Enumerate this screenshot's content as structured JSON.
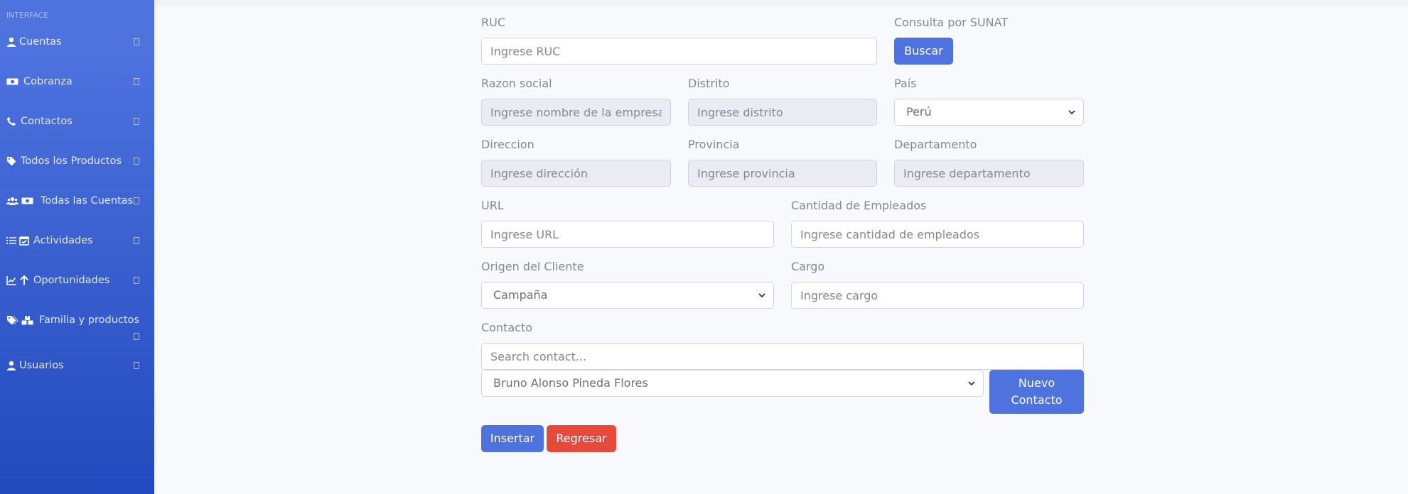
{
  "sidebar": {
    "heading": "INTERFACE",
    "items": [
      {
        "label": "Cuentas",
        "icons": [
          "user-icon"
        ]
      },
      {
        "label": "Cobranza",
        "icons": [
          "money-bill-icon"
        ]
      },
      {
        "label": "Contactos",
        "icons": [
          "phone-icon"
        ]
      },
      {
        "label": "Todos los Productos",
        "icons": [
          "tag-icon"
        ]
      },
      {
        "label": "Todas las Cuentas",
        "icons": [
          "users-icon",
          "money-bill-icon"
        ]
      },
      {
        "label": "Actividades",
        "icons": [
          "list-icon",
          "calendar-check-icon"
        ]
      },
      {
        "label": "Oportunidades",
        "icons": [
          "chart-line-icon",
          "arrow-up-icon"
        ]
      },
      {
        "label": "Familia y productos",
        "icons": [
          "tags-icon",
          "boxes-icon"
        ]
      },
      {
        "label": "Usuarios",
        "icons": [
          "user-icon"
        ]
      }
    ]
  },
  "form": {
    "ruc": {
      "label": "RUC",
      "placeholder": "Ingrese RUC"
    },
    "sunat": {
      "label": "Consulta por SUNAT",
      "button": "Buscar"
    },
    "razon_social": {
      "label": "Razon social",
      "placeholder": "Ingrese nombre de la empresa"
    },
    "distrito": {
      "label": "Distrito",
      "placeholder": "Ingrese distrito"
    },
    "pais": {
      "label": "País",
      "value": "Perú"
    },
    "direccion": {
      "label": "Direccion",
      "placeholder": "Ingrese dirección"
    },
    "provincia": {
      "label": "Provincia",
      "placeholder": "Ingrese provincia"
    },
    "departamento": {
      "label": "Departamento",
      "placeholder": "Ingrese departamento"
    },
    "url": {
      "label": "URL",
      "placeholder": "Ingrese URL"
    },
    "empleados": {
      "label": "Cantidad de Empleados",
      "placeholder": "Ingrese cantidad de empleados"
    },
    "origen": {
      "label": "Origen del Cliente",
      "value": "Campaña"
    },
    "cargo": {
      "label": "Cargo",
      "placeholder": "Ingrese cargo"
    },
    "contacto": {
      "label": "Contacto",
      "search_placeholder": "Search contact...",
      "selected": "Bruno Alonso Pineda Flores",
      "new_button_line1": "Nuevo",
      "new_button_line2": "Contacto"
    },
    "insert_button": "Insertar",
    "back_button": "Regresar"
  },
  "colors": {
    "sidebar_top": "#4e73df",
    "sidebar_bottom": "#224abe",
    "primary": "#4e73df",
    "danger": "#e74a3b",
    "background": "#f8f9fc"
  }
}
